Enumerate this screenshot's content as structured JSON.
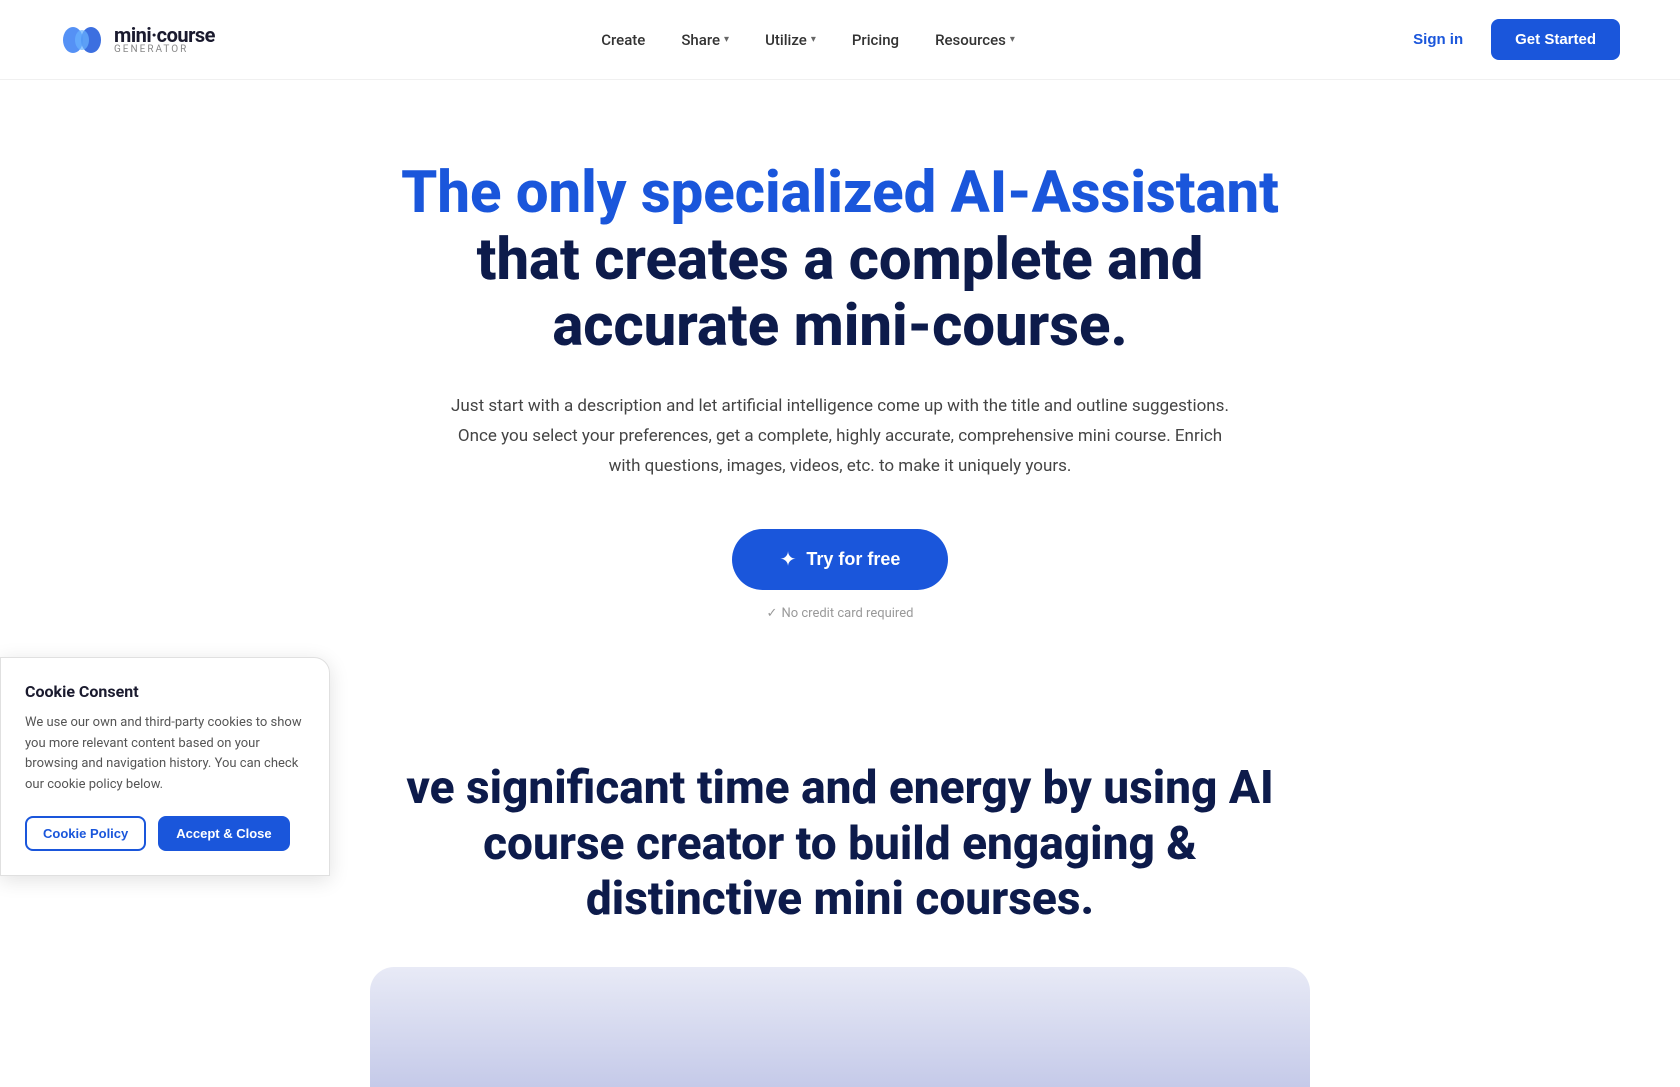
{
  "logo": {
    "name": "mini·course",
    "sub": "GENERATOR"
  },
  "nav": {
    "links": [
      {
        "label": "Create",
        "hasDropdown": false
      },
      {
        "label": "Share",
        "hasDropdown": true
      },
      {
        "label": "Utilize",
        "hasDropdown": true
      },
      {
        "label": "Pricing",
        "hasDropdown": false
      },
      {
        "label": "Resources",
        "hasDropdown": true
      }
    ],
    "sign_in": "Sign in",
    "get_started": "Get Started"
  },
  "hero": {
    "title_blue": "The only specialized AI-Assistant",
    "title_dark": " that creates a complete and accurate mini-course.",
    "description": "Just start with a description and let artificial intelligence come up with the title and outline suggestions. Once you select your preferences, get a complete, highly accurate, comprehensive mini course. Enrich with questions, images, videos, etc. to make it uniquely yours.",
    "cta_button": "Try for free",
    "cta_icon": "✦",
    "no_credit_card": "No credit card required",
    "check_mark": "✓"
  },
  "second_section": {
    "title_part1": "ve significant time and energy by using AI course creator to build engaging & distinctive mini courses."
  },
  "cookie": {
    "title": "Cookie Consent",
    "text": "We use our own and third-party cookies to show you more relevant content based on your browsing and navigation history. You can check our cookie policy below.",
    "policy_btn": "Cookie Policy",
    "accept_btn": "Accept & Close"
  }
}
